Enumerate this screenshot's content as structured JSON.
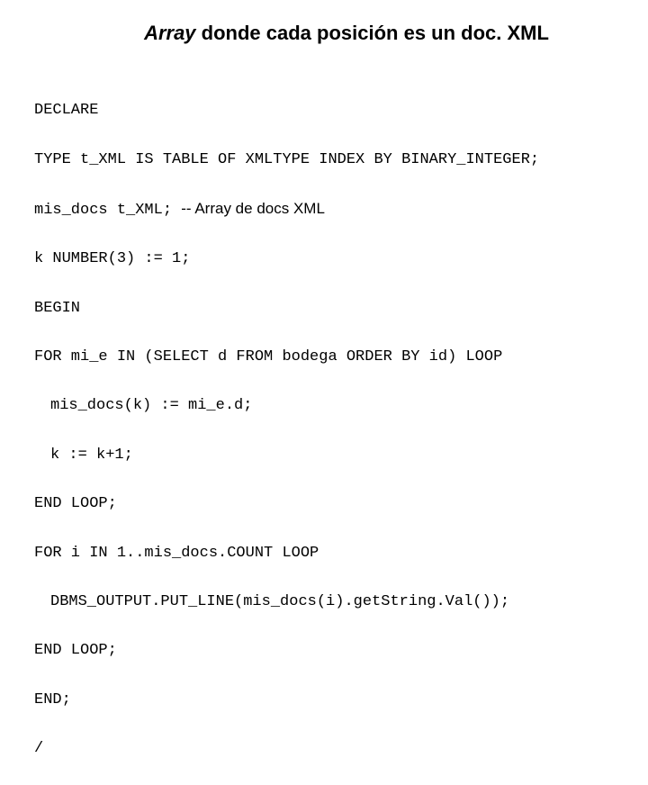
{
  "title": {
    "italic": "Array",
    "rest": " donde cada posición es un doc. XML"
  },
  "code": {
    "l1": "DECLARE",
    "l2": "TYPE t_XML IS TABLE OF XMLTYPE INDEX BY BINARY_INTEGER;",
    "l3a": "mis_docs t_XML; ",
    "l3b": "-- Array de docs XML",
    "l4": "k NUMBER(3) := 1;",
    "l5": "BEGIN",
    "l6": "FOR mi_e IN (SELECT d FROM bodega ORDER BY id) LOOP",
    "l7": "mis_docs(k) := mi_e.d;",
    "l8": "k := k+1;",
    "l9": "END LOOP;",
    "l10": "FOR i IN 1..mis_docs.COUNT LOOP",
    "l11": "DBMS_OUTPUT.PUT_LINE(mis_docs(i).getString.Val());",
    "l12": "END LOOP;",
    "l13": "END;",
    "l14": "/"
  }
}
